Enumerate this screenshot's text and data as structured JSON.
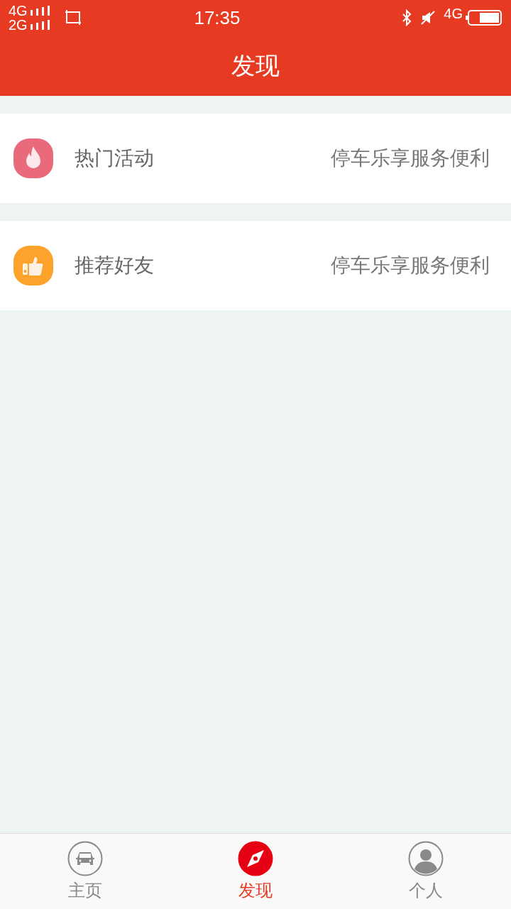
{
  "status_bar": {
    "network_1": "4G",
    "network_2": "2G",
    "time": "17:35",
    "network_3": "4G"
  },
  "header": {
    "title": "发现"
  },
  "items": [
    {
      "kind": "fire",
      "label": "热门活动",
      "detail": "停车乐享服务便利"
    },
    {
      "kind": "thumb",
      "label": "推荐好友",
      "detail": "停车乐享服务便利"
    }
  ],
  "tabs": [
    {
      "kind": "car",
      "label": "主页",
      "selected": false
    },
    {
      "kind": "compass",
      "label": "发现",
      "selected": true
    },
    {
      "kind": "person",
      "label": "个人",
      "selected": false
    }
  ]
}
